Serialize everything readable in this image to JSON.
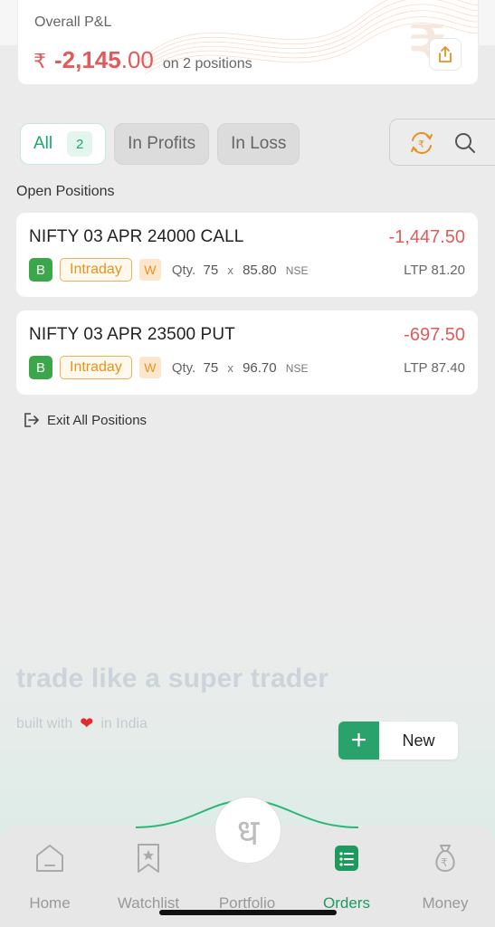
{
  "summary": {
    "title": "Overall P&L",
    "currency_symbol": "₹",
    "pnl_main": "-2,145",
    "pnl_decimal": ".00",
    "positions_text": "on 2 positions"
  },
  "filters": {
    "all_label": "All",
    "all_count": "2",
    "profits_label": "In Profits",
    "loss_label": "In Loss"
  },
  "section_title": "Open Positions",
  "positions": [
    {
      "name": "NIFTY 03 APR 24000 CALL",
      "pnl": "-1,447.50",
      "side": "B",
      "product": "Intraday",
      "expiry_tag": "W",
      "qty_label": "Qty.",
      "qty": "75",
      "x": "x",
      "price": "85.80",
      "exchange": "NSE",
      "ltp": "LTP 81.20"
    },
    {
      "name": "NIFTY 03 APR 23500 PUT",
      "pnl": "-697.50",
      "side": "B",
      "product": "Intraday",
      "expiry_tag": "W",
      "qty_label": "Qty.",
      "qty": "75",
      "x": "x",
      "price": "96.70",
      "exchange": "NSE",
      "ltp": "LTP 87.40"
    }
  ],
  "exit_all_label": "Exit All Positions",
  "tagline": "trade like a super trader",
  "built_prefix": "built with",
  "built_heart": "❤",
  "built_suffix": "in India",
  "new_button": {
    "plus": "+",
    "label": "New"
  },
  "tabbar": {
    "home": "Home",
    "watchlist": "Watchlist",
    "portfolio": "Portfolio",
    "orders": "Orders",
    "money": "Money",
    "center_glyph": "ध"
  },
  "colors": {
    "accent_green": "#1f9a5f",
    "loss_red": "#e25b5b",
    "intraday_orange": "#e8921f"
  }
}
